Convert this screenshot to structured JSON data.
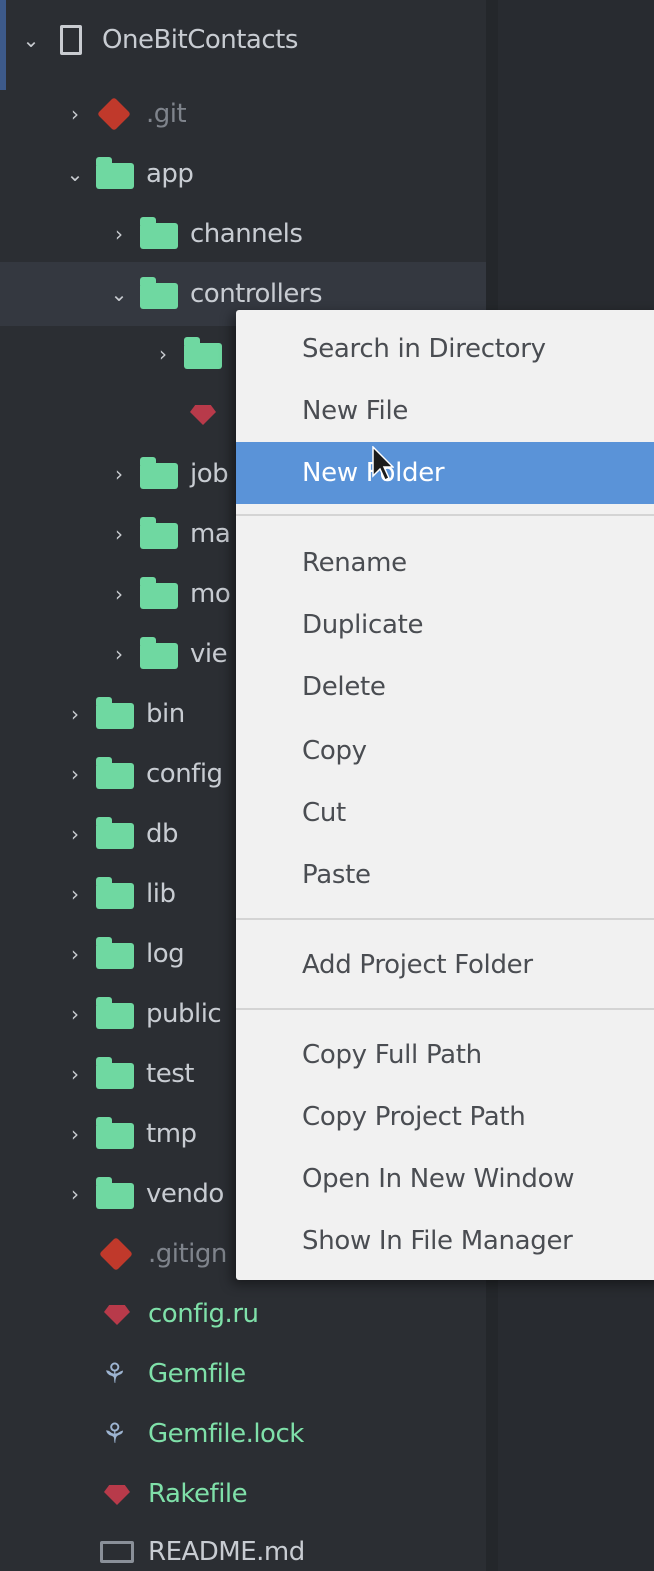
{
  "project": {
    "name": "OneBitContacts"
  },
  "tree": {
    "git": ".git",
    "app": "app",
    "channels": "channels",
    "controllers": "controllers",
    "jobs_partial": "job",
    "mailers_partial": "ma",
    "models_partial": "mo",
    "views_partial": "vie",
    "bin": "bin",
    "config": "config",
    "db": "db",
    "lib": "lib",
    "log": "log",
    "public": "public",
    "test": "test",
    "tmp": "tmp",
    "vendor_partial": "vendo",
    "gitignore_partial": ".gitign",
    "config_ru": "config.ru",
    "gemfile": "Gemfile",
    "gemfile_lock": "Gemfile.lock",
    "rakefile": "Rakefile",
    "readme": "README.md"
  },
  "icons": {
    "chevron_right": "›",
    "chevron_down": "⌄",
    "gem": "⚘"
  },
  "context_menu": {
    "search_in_directory": "Search in Directory",
    "new_file": "New File",
    "new_folder": "New Folder",
    "rename": "Rename",
    "duplicate": "Duplicate",
    "delete": "Delete",
    "copy": "Copy",
    "cut": "Cut",
    "paste": "Paste",
    "add_project_folder": "Add Project Folder",
    "copy_full_path": "Copy Full Path",
    "copy_project_path": "Copy Project Path",
    "open_in_new_window": "Open In New Window",
    "show_in_file_manager": "Show In File Manager"
  },
  "colors": {
    "folder": "#6fd8a1",
    "selection": "#5a93d8",
    "git": "#c0392b",
    "ruby": "#b83a4a"
  }
}
